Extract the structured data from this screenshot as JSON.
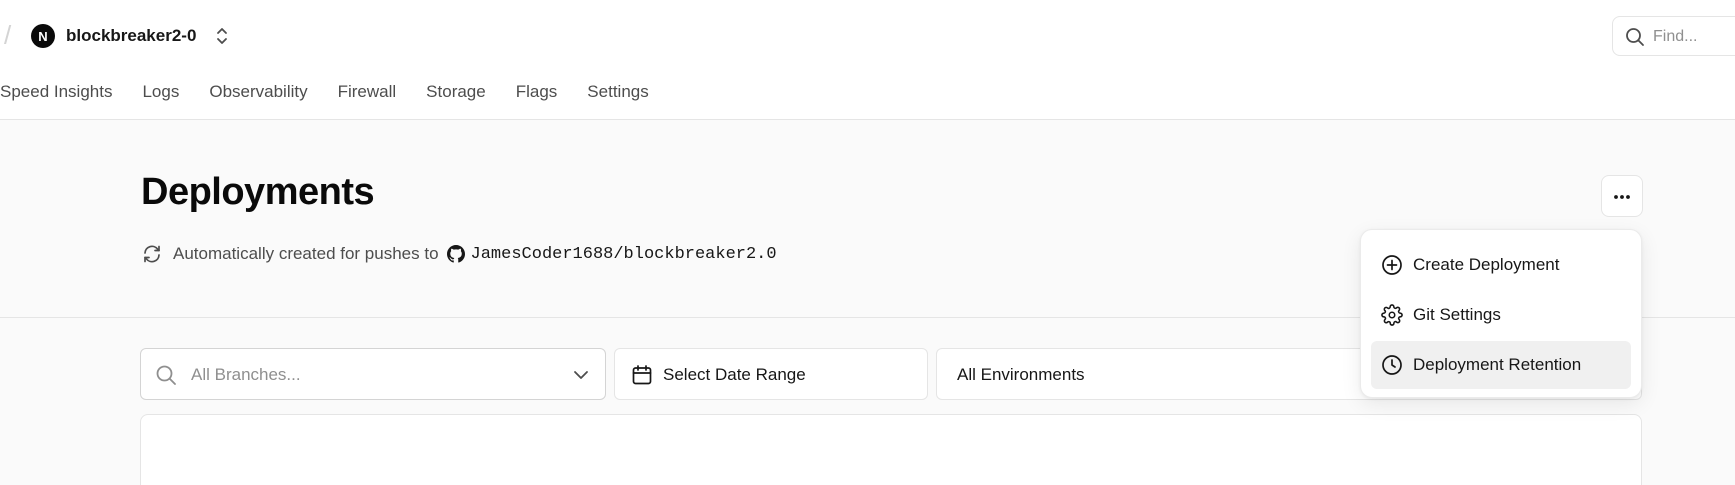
{
  "topbar": {
    "separator": "/",
    "project_logo": "N",
    "project_name": "blockbreaker2-0",
    "search_placeholder": "Find..."
  },
  "tabs": [
    {
      "label": "Speed Insights"
    },
    {
      "label": "Logs"
    },
    {
      "label": "Observability"
    },
    {
      "label": "Firewall"
    },
    {
      "label": "Storage"
    },
    {
      "label": "Flags"
    },
    {
      "label": "Settings"
    }
  ],
  "page": {
    "title": "Deployments",
    "subtitle": "Automatically created for pushes to",
    "repo": "JamesCoder1688/blockbreaker2.0"
  },
  "filters": {
    "branches_placeholder": "All Branches...",
    "date_range": "Select Date Range",
    "environments": "All Environments"
  },
  "menu": {
    "items": [
      {
        "label": "Create Deployment",
        "icon": "plus-circle-icon"
      },
      {
        "label": "Git Settings",
        "icon": "gear-icon"
      },
      {
        "label": "Deployment Retention",
        "icon": "clock-icon"
      }
    ]
  },
  "colors": {
    "page_bg": "#fafafa",
    "surface": "#ffffff",
    "border": "#e5e5e5",
    "text": "#171717",
    "muted": "#8f8f8f",
    "menu_hover": "#f0f0f0"
  }
}
